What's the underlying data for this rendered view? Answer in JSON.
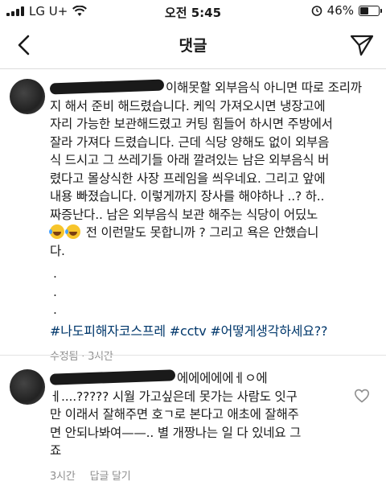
{
  "status_bar": {
    "carrier": "LG U+",
    "time": "오전 5:45",
    "battery": "46%",
    "battery_level": 0.46
  },
  "header": {
    "title": "댓글",
    "icons": [
      "back-chevron-icon",
      "send-icon"
    ]
  },
  "comment1": {
    "lines": [
      "이해못할 외부음식 아니면 따로 조리까",
      "지 해서 준비 해드렸습니다. 케익 가져오시면 냉장고에",
      "자리 가능한 보관해드렸고 커팅 힘들어 하시면 주방에서",
      "잘라 가져다 드렸습니다. 근데 식당 양해도 없이 외부음",
      "식 드시고 그 쓰레기들 아래 깔려있는 남은 외부음식 버",
      "렸다고 몰상식한 사장 프레임을 씌우네요. 그리고 앞에",
      "내용 빠졌습니다. 이렇게까지 장사를 해야하나 ..? 하..",
      "짜증난다.. 남은 외부음식 보관 해주는 식당이 어딨노",
      "전 이런말도 못합니까 ? 그리고 욕은 안했습니",
      "다."
    ],
    "dots": [
      ".",
      ".",
      "."
    ],
    "hashtags": "#나도피해자코스프레 #cctv #어떻게생각하세요??",
    "edited": "수정됨",
    "time": "3시간"
  },
  "comment2": {
    "lines": [
      "에에에에에ㅔㅇ에",
      "ㅔ....????? 시월 가고싶은데 못가는 사람도 잇구",
      "만 이래서 잘해주면 호ㄱ로 본다고 애초에 잘해주",
      "면 안되나봐여——.. 별 개짱나는 일 다 있네요 그",
      "죠"
    ],
    "time": "3시간",
    "reply": "답글 달기",
    "icons": [
      "heart-icon"
    ]
  }
}
